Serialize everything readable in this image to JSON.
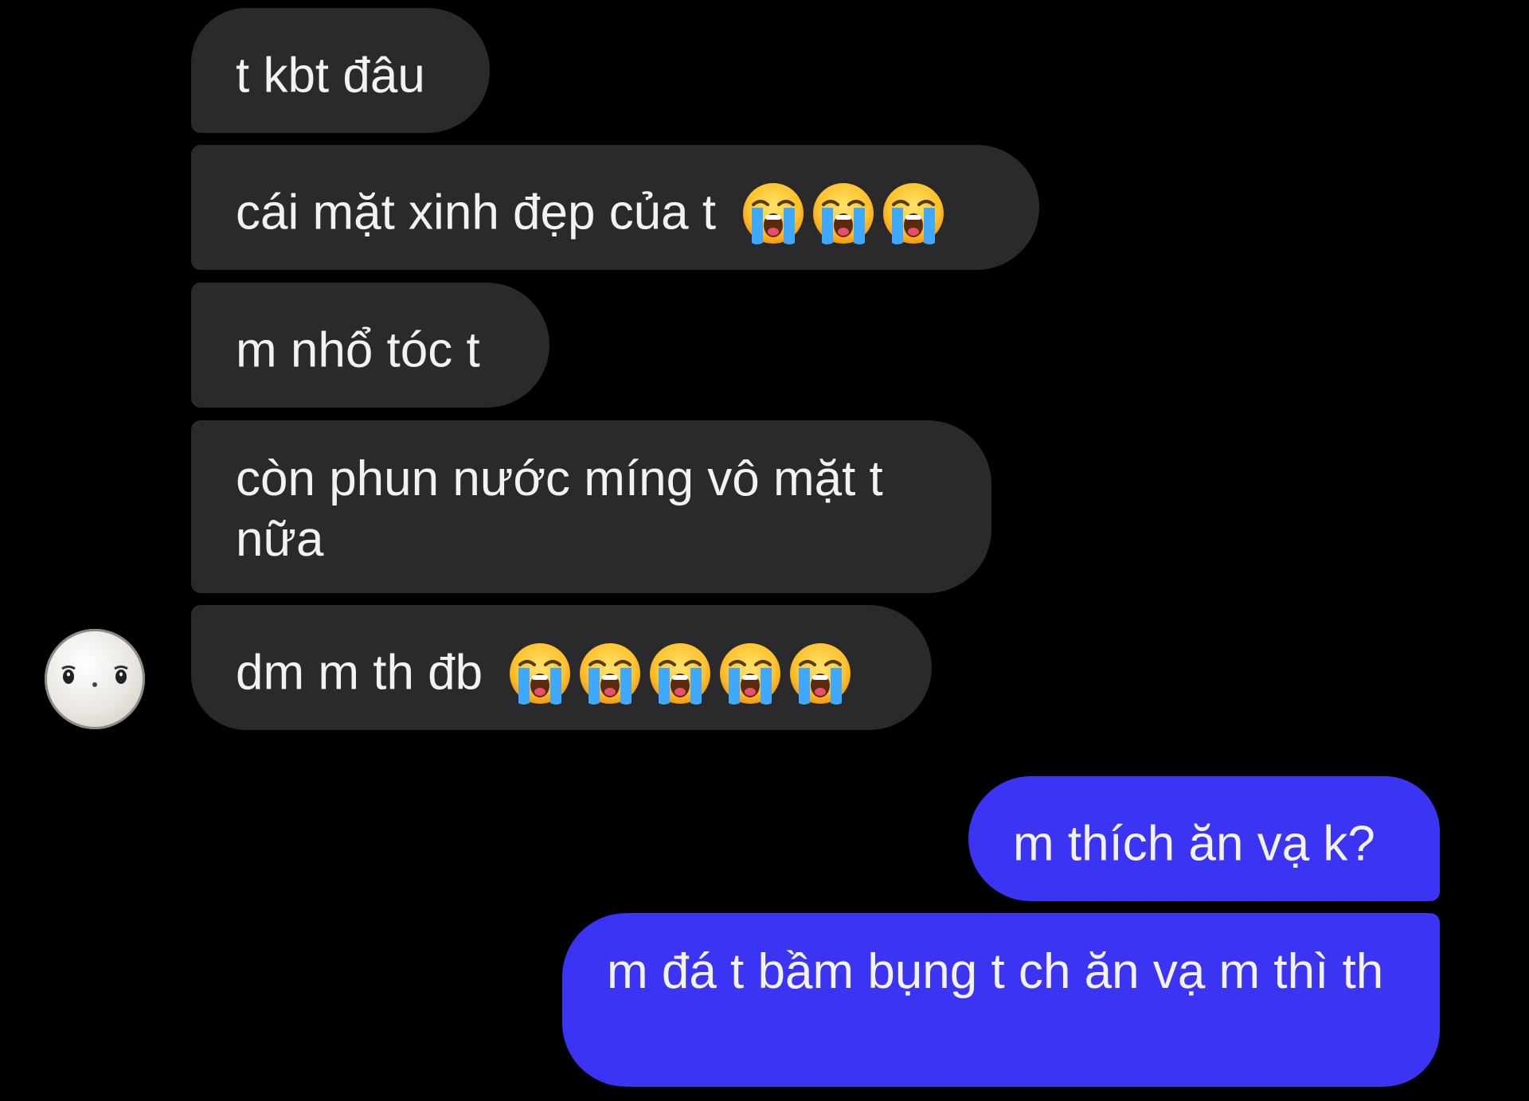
{
  "contact": {
    "avatar_icon": "ghost-face-avatar-icon"
  },
  "messages": [
    {
      "direction": "incoming",
      "text": "t kbt đâu"
    },
    {
      "direction": "incoming",
      "text": "cái mặt xinh đẹp của t",
      "emoji_icon": "loudly-crying-face-icon",
      "emoji_count": 3
    },
    {
      "direction": "incoming",
      "text": "m nhổ tóc t"
    },
    {
      "direction": "incoming",
      "text": "còn phun nước míng vô mặt t nữa"
    },
    {
      "direction": "incoming",
      "text": "dm m th đb",
      "emoji_icon": "loudly-crying-face-icon",
      "emoji_count": 5
    },
    {
      "direction": "outgoing",
      "text": "m thích ăn vạ k?"
    },
    {
      "direction": "outgoing",
      "text": "m đá t bầm bụng t ch ăn vạ m thì th"
    }
  ],
  "colors": {
    "background": "#000000",
    "incoming_bubble": "#2a2a2c",
    "outgoing_bubble": "#3b34f2",
    "text": "#f2f2f2"
  }
}
